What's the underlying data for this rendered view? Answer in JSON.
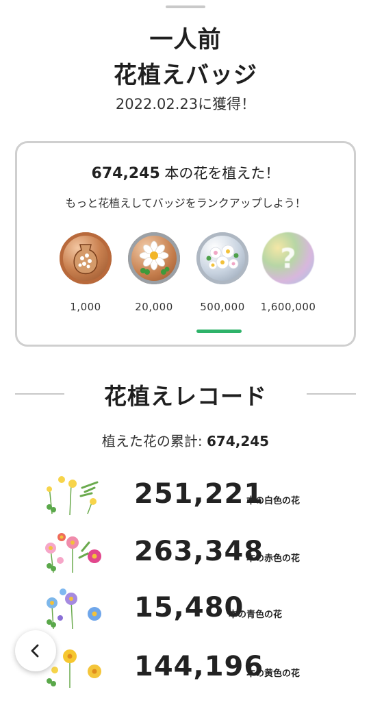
{
  "header": {
    "title_line1": "一人前",
    "title_line2": "花植えバッジ",
    "acquired_date": "2022.02.23に獲得！"
  },
  "badge_card": {
    "planted_count": "674,245",
    "planted_suffix": " 本の花を植えた！",
    "rank_up_message": "もっと花植えしてバッジをランクアップしよう！",
    "badges": [
      {
        "label": "1,000",
        "icon": "bronze-vase-badge-icon"
      },
      {
        "label": "20,000",
        "icon": "bronze-daisy-badge-icon"
      },
      {
        "label": "500,000",
        "icon": "silver-flowers-badge-icon"
      },
      {
        "label": "1,600,000",
        "icon": "locked-mystery-badge-icon"
      }
    ],
    "accent_color": "#2fb36a"
  },
  "record": {
    "title": "花植えレコード",
    "total_label": "植えた花の累計: ",
    "total_value": "674,245",
    "rows": [
      {
        "count": "251,221",
        "label": "本の白色の花",
        "icon": "white-flowers-icon"
      },
      {
        "count": "263,348",
        "label": "本の赤色の花",
        "icon": "red-flowers-icon"
      },
      {
        "count": "15,480",
        "label": "本の青色の花",
        "icon": "blue-flowers-icon"
      },
      {
        "count": "144,196",
        "label": "本の黄色の花",
        "icon": "yellow-flowers-icon"
      }
    ]
  },
  "nav": {
    "back_icon": "chevron-left-icon"
  }
}
